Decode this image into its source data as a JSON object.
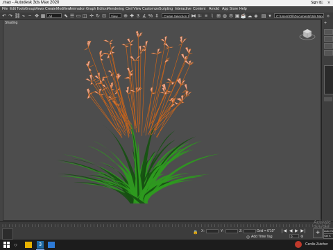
{
  "window": {
    "title": ".max - Autodesk 3ds Max 2020",
    "signin": "Sign In",
    "controls": [
      "minimize",
      "maximize",
      "close"
    ]
  },
  "menubar": {
    "items": [
      "File",
      "Edit",
      "Tools",
      "Group",
      "Views",
      "Create",
      "Modifiers",
      "Animation",
      "Graph Editors",
      "Rendering",
      "Civil View",
      "Customize",
      "Scripting",
      "Interactive",
      "Content",
      "Arnold",
      "App Store",
      "Help"
    ]
  },
  "toolbar": {
    "selection_filter": "All",
    "view_dropdown": "View",
    "selection_set": "Create Selection Se",
    "workspace_path": "C:\\Users\\Olli\\Documents\\3ds Max 2020"
  },
  "viewport": {
    "label": "Shading",
    "plant": {
      "blade_color": "#2e9a1e",
      "blade_dark": "#174f12",
      "flower_color": "#e7a99a",
      "flower_stem": "#c8641c"
    },
    "background": "#4d4d4d"
  },
  "statusbar": {
    "coord_x": "",
    "coord_y": "",
    "coord_z": "",
    "grid": "Grid = 0'10\"",
    "add_time_tag": "Add Time Tag",
    "frame": "0",
    "auto_key": "Auto Key",
    "set_key": "Set K",
    "watermark_line1": "Activate",
    "watermark_line2": "Go to Sett"
  },
  "taskbar": {
    "user": "Cerdis Zutcher"
  },
  "colors": {
    "menubar_bg": "#444444",
    "titlebar_bg": "#f0f0f0",
    "accent": "#3a86c8"
  }
}
